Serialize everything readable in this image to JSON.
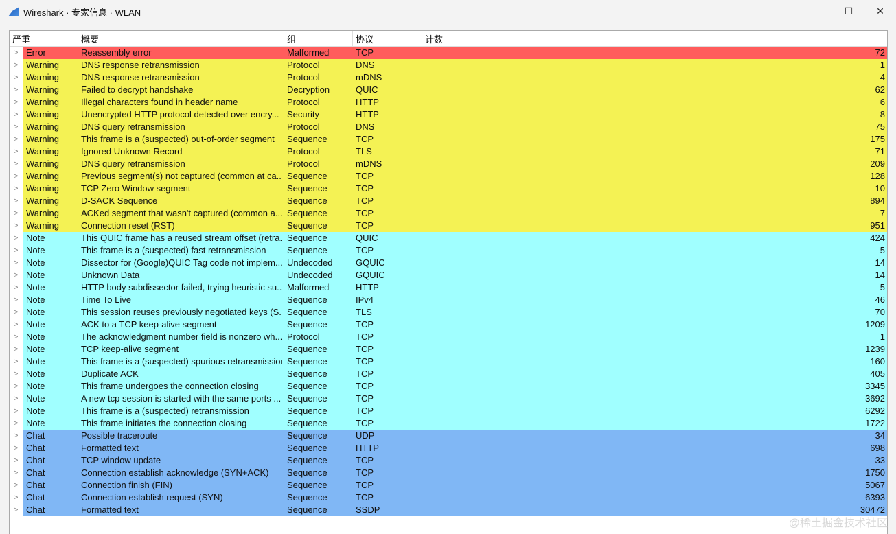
{
  "window": {
    "title": "Wireshark · 专家信息 · WLAN",
    "minimize": "—",
    "maximize": "☐",
    "close": "✕"
  },
  "columns": {
    "severity": "严重",
    "summary": "概要",
    "group": "组",
    "protocol": "协议",
    "count": "计数"
  },
  "colors": {
    "Error": "#ff5c5c",
    "Warning": "#f4f254",
    "Note": "#a0ffff",
    "Chat": "#80b7f5"
  },
  "rows": [
    [
      "Error",
      "Reassembly error",
      "Malformed",
      "TCP",
      "72"
    ],
    [
      "Warning",
      "DNS response retransmission",
      "Protocol",
      "DNS",
      "1"
    ],
    [
      "Warning",
      "DNS response retransmission",
      "Protocol",
      "mDNS",
      "4"
    ],
    [
      "Warning",
      "Failed to decrypt handshake",
      "Decryption",
      "QUIC",
      "62"
    ],
    [
      "Warning",
      "Illegal characters found in header name",
      "Protocol",
      "HTTP",
      "6"
    ],
    [
      "Warning",
      "Unencrypted HTTP protocol detected over encry...",
      "Security",
      "HTTP",
      "8"
    ],
    [
      "Warning",
      "DNS query retransmission",
      "Protocol",
      "DNS",
      "75"
    ],
    [
      "Warning",
      "This frame is a (suspected) out-of-order segment",
      "Sequence",
      "TCP",
      "175"
    ],
    [
      "Warning",
      "Ignored Unknown Record",
      "Protocol",
      "TLS",
      "71"
    ],
    [
      "Warning",
      "DNS query retransmission",
      "Protocol",
      "mDNS",
      "209"
    ],
    [
      "Warning",
      "Previous segment(s) not captured (common at ca...",
      "Sequence",
      "TCP",
      "128"
    ],
    [
      "Warning",
      "TCP Zero Window segment",
      "Sequence",
      "TCP",
      "10"
    ],
    [
      "Warning",
      "D-SACK Sequence",
      "Sequence",
      "TCP",
      "894"
    ],
    [
      "Warning",
      "ACKed segment that wasn't captured (common a...",
      "Sequence",
      "TCP",
      "7"
    ],
    [
      "Warning",
      "Connection reset (RST)",
      "Sequence",
      "TCP",
      "951"
    ],
    [
      "Note",
      "This QUIC frame has a reused stream offset (retra...",
      "Sequence",
      "QUIC",
      "424"
    ],
    [
      "Note",
      "This frame is a (suspected) fast retransmission",
      "Sequence",
      "TCP",
      "5"
    ],
    [
      "Note",
      "Dissector for (Google)QUIC Tag code not implem...",
      "Undecoded",
      "GQUIC",
      "14"
    ],
    [
      "Note",
      "Unknown Data",
      "Undecoded",
      "GQUIC",
      "14"
    ],
    [
      "Note",
      "HTTP body subdissector failed, trying heuristic su...",
      "Malformed",
      "HTTP",
      "5"
    ],
    [
      "Note",
      "Time To Live",
      "Sequence",
      "IPv4",
      "46"
    ],
    [
      "Note",
      "This session reuses previously negotiated keys (S...",
      "Sequence",
      "TLS",
      "70"
    ],
    [
      "Note",
      "ACK to a TCP keep-alive segment",
      "Sequence",
      "TCP",
      "1209"
    ],
    [
      "Note",
      "The acknowledgment number field is nonzero wh...",
      "Protocol",
      "TCP",
      "1"
    ],
    [
      "Note",
      "TCP keep-alive segment",
      "Sequence",
      "TCP",
      "1239"
    ],
    [
      "Note",
      "This frame is a (suspected) spurious retransmission",
      "Sequence",
      "TCP",
      "160"
    ],
    [
      "Note",
      "Duplicate ACK",
      "Sequence",
      "TCP",
      "405"
    ],
    [
      "Note",
      "This frame undergoes the connection closing",
      "Sequence",
      "TCP",
      "3345"
    ],
    [
      "Note",
      "A new tcp session is started with the same ports ...",
      "Sequence",
      "TCP",
      "3692"
    ],
    [
      "Note",
      "This frame is a (suspected) retransmission",
      "Sequence",
      "TCP",
      "6292"
    ],
    [
      "Note",
      "This frame initiates the connection closing",
      "Sequence",
      "TCP",
      "1722"
    ],
    [
      "Chat",
      "Possible traceroute",
      "Sequence",
      "UDP",
      "34"
    ],
    [
      "Chat",
      "Formatted text",
      "Sequence",
      "HTTP",
      "698"
    ],
    [
      "Chat",
      "TCP window update",
      "Sequence",
      "TCP",
      "33"
    ],
    [
      "Chat",
      "Connection establish acknowledge (SYN+ACK)",
      "Sequence",
      "TCP",
      "1750"
    ],
    [
      "Chat",
      "Connection finish (FIN)",
      "Sequence",
      "TCP",
      "5067"
    ],
    [
      "Chat",
      "Connection establish request (SYN)",
      "Sequence",
      "TCP",
      "6393"
    ],
    [
      "Chat",
      "Formatted text",
      "Sequence",
      "SSDP",
      "30472"
    ]
  ],
  "watermark": "@稀土掘金技术社区"
}
